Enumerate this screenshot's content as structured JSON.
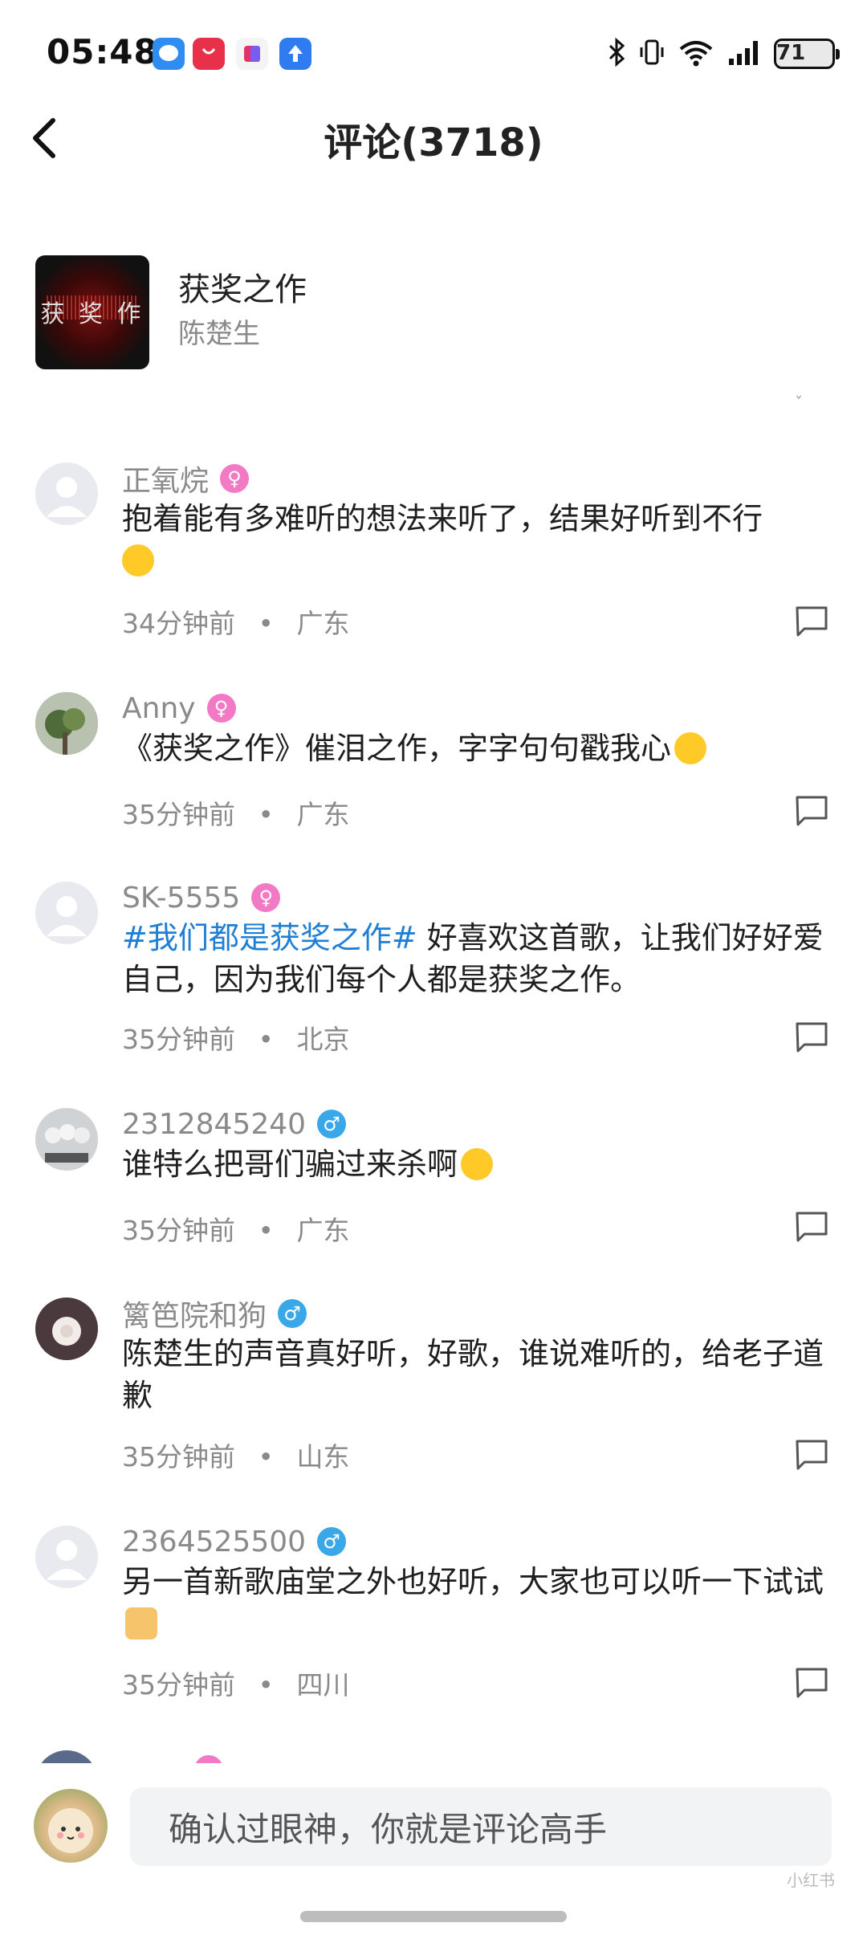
{
  "status_bar": {
    "time": "05:48",
    "battery": "71"
  },
  "header": {
    "title": "评论(3718)"
  },
  "song": {
    "title": "获奖之作",
    "artist": "陈楚生"
  },
  "comments": [
    {
      "name": "正氧烷",
      "gender": "female",
      "text": "抱着能有多难听的想法来听了，结果好听到不行",
      "emoji": "star-eyes-emoji",
      "time": "34分钟前",
      "location": "广东",
      "separator": "•"
    },
    {
      "name": "Anny",
      "gender": "female",
      "text": "《获奖之作》催泪之作，字字句句戳我心",
      "emoji": "crying-emoji",
      "time": "35分钟前",
      "location": "广东",
      "separator": "•"
    },
    {
      "name": "SK-5555",
      "gender": "female",
      "hashtag": "#我们都是获奖之作#",
      "text": " 好喜欢这首歌，让我们好好爱自己，因为我们每个人都是获奖之作。",
      "time": "35分钟前",
      "location": "北京",
      "separator": "•"
    },
    {
      "name": "2312845240",
      "gender": "male",
      "text": "谁特么把哥们骗过来杀啊",
      "emoji": "smile-emoji",
      "time": "35分钟前",
      "location": "广东",
      "separator": "•"
    },
    {
      "name": "篱笆院和狗",
      "gender": "male",
      "text": "陈楚生的声音真好听，好歌，谁说难听的，给老子道歉",
      "time": "35分钟前",
      "location": "山东",
      "separator": "•"
    },
    {
      "name": "2364525500",
      "gender": "male",
      "text": "另一首新歌庙堂之外也好听，大家也可以听一下试试",
      "emoji": "handshake-emoji",
      "time": "35分钟前",
      "location": "四川",
      "separator": "•"
    }
  ],
  "bottom": {
    "input_placeholder": "确认过眼神，你就是评论高手",
    "watermark": "小红书"
  },
  "gender_symbols": {
    "female": "♀",
    "male": "♂"
  },
  "colors": {
    "hashtag": "#1e7fd4",
    "female": "#f27ac4",
    "male": "#3aa8e8"
  }
}
